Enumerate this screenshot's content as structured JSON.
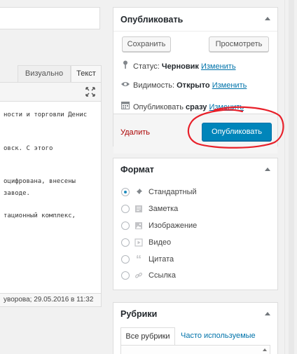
{
  "editor": {
    "tabs": {
      "visual": "Визуально",
      "text": "Текст"
    },
    "lines": [
      "ности и торговли Денис",
      "овск. С этого",
      "оцифрована, внесены",
      "заводе.",
      "тационный комплекс,"
    ],
    "status": "уворова; 29.05.2016 в 11:32"
  },
  "publish": {
    "title": "Опубликовать",
    "save_label": "Сохранить",
    "preview_label": "Просмотреть",
    "status_label": "Статус:",
    "status_value": "Черновик",
    "status_edit": "Изменить",
    "visibility_label": "Видимость:",
    "visibility_value": "Открыто",
    "visibility_edit": "Изменить",
    "schedule_label": "Опубликовать",
    "schedule_value": "сразу",
    "schedule_edit": "Изменить",
    "delete_label": "Удалить",
    "publish_label": "Опубликовать"
  },
  "format": {
    "title": "Формат",
    "options": [
      {
        "label": "Стандартный",
        "icon": "pin-icon",
        "checked": true
      },
      {
        "label": "Заметка",
        "icon": "aside-icon",
        "checked": false
      },
      {
        "label": "Изображение",
        "icon": "image-icon",
        "checked": false
      },
      {
        "label": "Видео",
        "icon": "video-icon",
        "checked": false
      },
      {
        "label": "Цитата",
        "icon": "quote-icon",
        "checked": false
      },
      {
        "label": "Ссылка",
        "icon": "link-icon",
        "checked": false
      }
    ]
  },
  "categories": {
    "title": "Рубрики",
    "tab_all": "Все рубрики",
    "tab_popular": "Часто используемые"
  },
  "colors": {
    "accent": "#0085ba",
    "link": "#0073aa",
    "delete": "#aa0000",
    "annotation": "#e8202a"
  }
}
